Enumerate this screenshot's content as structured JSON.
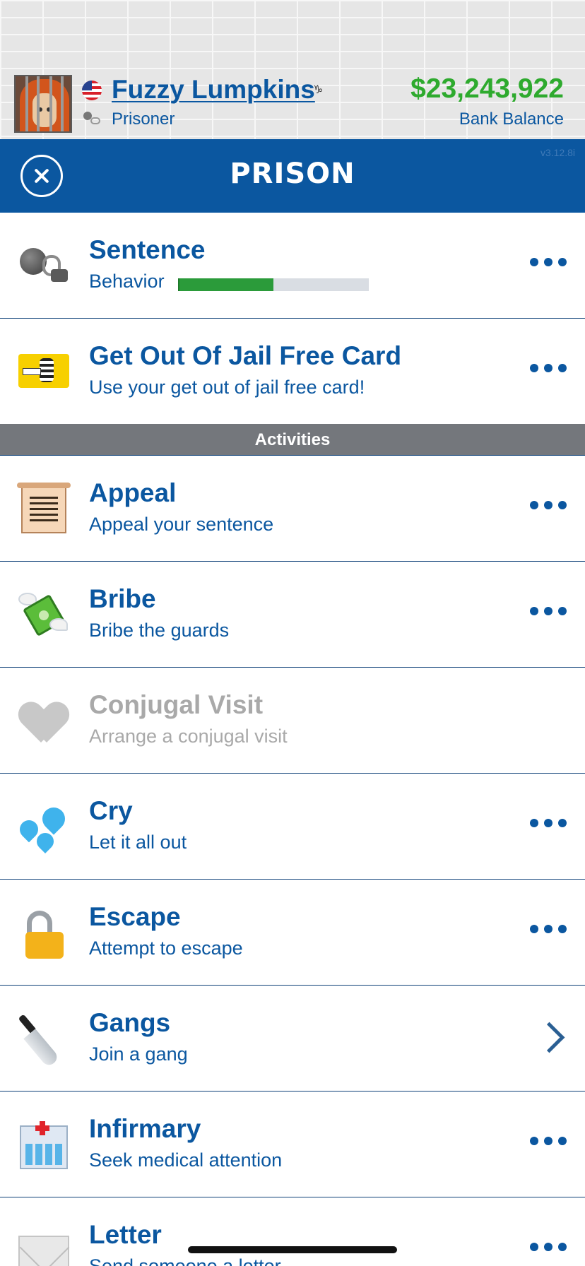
{
  "header": {
    "name": "Fuzzy Lumpkins",
    "occupation": "Prisoner",
    "balance": "$23,243,922",
    "balance_label": "Bank Balance"
  },
  "titlebar": {
    "title": "PRISON",
    "version": "v3.12.8i"
  },
  "sentence": {
    "title": "Sentence",
    "behavior_label": "Behavior",
    "behavior_level": 0.5
  },
  "jail_card": {
    "title": "Get Out Of Jail Free Card",
    "subtitle": "Use your get out of jail free card!"
  },
  "section": {
    "label": "Activities"
  },
  "activities": [
    {
      "title": "Appeal",
      "subtitle": "Appeal your sentence",
      "icon": "scroll-icon",
      "action": "more",
      "enabled": true
    },
    {
      "title": "Bribe",
      "subtitle": "Bribe the guards",
      "icon": "money-with-wings-icon",
      "action": "more",
      "enabled": true
    },
    {
      "title": "Conjugal Visit",
      "subtitle": "Arrange a conjugal visit",
      "icon": "heart-icon",
      "action": "none",
      "enabled": false
    },
    {
      "title": "Cry",
      "subtitle": "Let it all out",
      "icon": "sweat-droplets-icon",
      "action": "more",
      "enabled": true
    },
    {
      "title": "Escape",
      "subtitle": "Attempt to escape",
      "icon": "unlocked-padlock-icon",
      "action": "more",
      "enabled": true
    },
    {
      "title": "Gangs",
      "subtitle": "Join a gang",
      "icon": "knife-icon",
      "action": "chevron",
      "enabled": true
    },
    {
      "title": "Infirmary",
      "subtitle": "Seek medical attention",
      "icon": "hospital-icon",
      "action": "more",
      "enabled": true
    },
    {
      "title": "Letter",
      "subtitle": "Send someone a letter",
      "icon": "envelope-icon",
      "action": "more",
      "enabled": true
    }
  ],
  "colors": {
    "brand_blue": "#0b57a0",
    "balance_green": "#2eaa2e",
    "behavior_green": "#2b9b3a",
    "section_gray": "#74777c",
    "disabled_gray": "#a9a9a9"
  }
}
